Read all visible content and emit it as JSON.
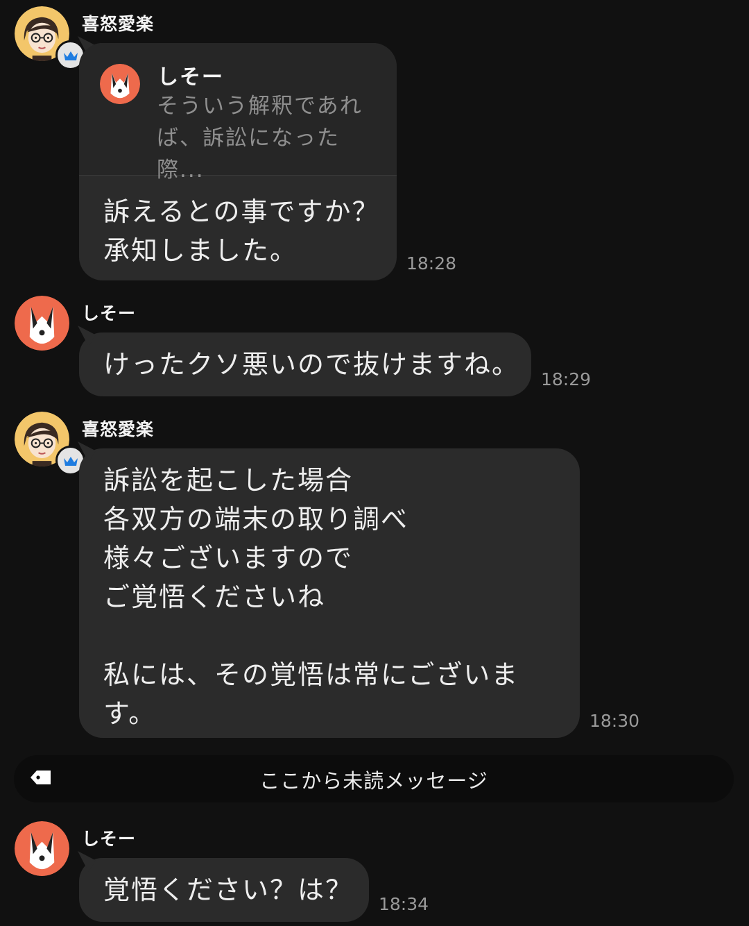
{
  "messages": [
    {
      "sender": "喜怒愛楽",
      "reply": {
        "name": "しそー",
        "snippet": "そういう解釈であれば、訴訟になった際..."
      },
      "text": "訴えるとの事ですか？\n承知しました。",
      "time": "18:28"
    },
    {
      "sender": "しそー",
      "text": "けったクソ悪いので抜けますね。",
      "time": "18:29"
    },
    {
      "sender": "喜怒愛楽",
      "text": "訴訟を起こした場合\n各双方の端末の取り調べ\n様々ございますので\nご覚悟くださいね\n\n私には、その覚悟は常にございま\nす。",
      "time": "18:30"
    },
    {
      "sender": "しそー",
      "text": "覚悟ください？は？",
      "time": "18:34"
    }
  ],
  "unread_divider": {
    "label": "ここから未読メッセージ",
    "icon": "tag-icon"
  },
  "icons": {
    "user_a_badge": "crown-icon",
    "user_b_avatar": "dog-icon"
  },
  "colors": {
    "background": "#111111",
    "bubble": "#2b2b2b",
    "badge": "#1e7ce0"
  }
}
